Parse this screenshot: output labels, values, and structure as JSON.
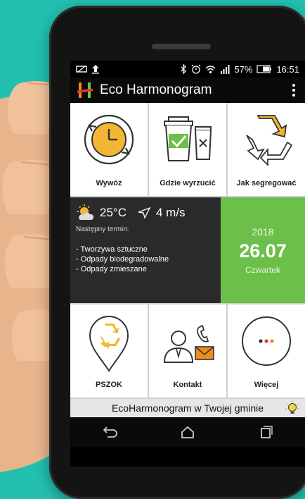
{
  "status": {
    "battery": "57%",
    "time": "16:51"
  },
  "app": {
    "title": "Eco Harmonogram"
  },
  "tiles_top": [
    {
      "label": "Wywóz"
    },
    {
      "label": "Gdzie wyrzucić"
    },
    {
      "label": "Jak segregować"
    }
  ],
  "weather": {
    "temperature": "25°C",
    "wind": "4 m/s",
    "next_label": "Następny termin:",
    "items": [
      "- Tworzywa sztuczne",
      "- Odpady biodegradowalne",
      "- Odpady zmieszane"
    ]
  },
  "date": {
    "year": "2018",
    "day": "26.07",
    "weekday": "Czwartek"
  },
  "tiles_bottom": [
    {
      "label": "PSZOK"
    },
    {
      "label": "Kontakt"
    },
    {
      "label": "Więcej"
    }
  ],
  "footer": {
    "text": "EcoHarmonogram w Twojej gminie"
  },
  "colors": {
    "background": "#22bfae",
    "accent_green": "#6cc04a",
    "weather_bg": "#2a2a2a",
    "logo_orange": "#f08a1c"
  }
}
